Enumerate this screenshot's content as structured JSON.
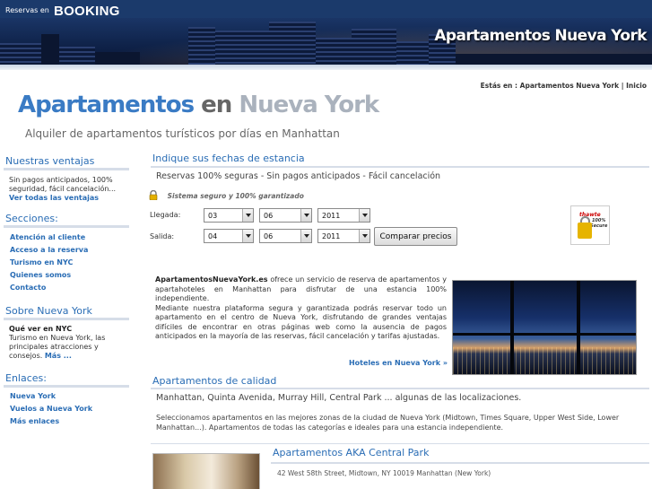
{
  "topbar": {
    "pre": "Reservas en",
    "brand": "BOOKING"
  },
  "banner": {
    "title": "Apartamentos Nueva York"
  },
  "breadcrumb": {
    "prefix": "Estás en :",
    "current": "Apartamentos Nueva York",
    "sep": "|",
    "home": "Inicio"
  },
  "page": {
    "title_1": "Apartamentos",
    "title_2": "en",
    "title_3": "Nueva York",
    "subtitle": "Alquiler de apartamentos turísticos por días en Manhattan"
  },
  "sidebar": {
    "ventas": {
      "heading": "Nuestras ventajas",
      "text": "Sin pagos anticipados, 100% seguridad, fácil cancelación...",
      "link": "Ver todas las ventajas"
    },
    "secciones": {
      "heading": "Secciones:",
      "items": [
        "Atención al cliente",
        "Acceso a la reserva",
        "Turismo en NYC",
        "Quienes somos",
        "Contacto"
      ]
    },
    "sobre": {
      "heading": "Sobre Nueva York",
      "bold": "Qué ver en NYC",
      "text": "Turismo en Nueva York, las principales atracciones y consejos.",
      "link": "Más ..."
    },
    "enlaces": {
      "heading": "Enlaces:",
      "items": [
        "Nueva York",
        "Vuelos a Nueva York",
        "Más enlaces"
      ]
    }
  },
  "search": {
    "heading": "Indique sus fechas de estancia",
    "tagline": "Reservas 100% seguras - Sin pagos anticipados - Fácil cancelación",
    "secure": "Sistema seguro y 100% garantizado",
    "checkin_label": "Llegada:",
    "checkout_label": "Salida:",
    "checkin": {
      "day": "03",
      "month": "06",
      "year": "2011"
    },
    "checkout": {
      "day": "04",
      "month": "06",
      "year": "2011"
    },
    "button": "Comparar precios"
  },
  "badge": {
    "name": "thawte",
    "line1": "100%",
    "line2": "Secure"
  },
  "intro": {
    "brand": "ApartamentosNuevaYork.es",
    "p1": "ofrece un servicio de reserva de apartamentos y apartahoteles en Manhattan para disfrutar de una estancia 100% independiente.",
    "p2": "Mediante nuestra plataforma segura y garantizada podrás reservar todo un apartamento en el centro de Nueva York, disfrutando de grandes ventajas difíciles de encontrar en otras páginas web como la ausencia de pagos anticipados en la mayoría de las reservas, fácil cancelación y tarifas ajustadas.",
    "link": "Hoteles en Nueva York »"
  },
  "calidad": {
    "heading": "Apartamentos de calidad",
    "line1": "Manhattan, Quinta Avenida, Murray Hill, Central Park ... algunas de las localizaciones.",
    "line2": "Seleccionamos apartamentos en las mejores zonas de la ciudad de Nueva York (Midtown, Times Square, Upper West Side, Lower",
    "line3": "Manhattan...). Apartamentos de todas las categorías e ideales para una estancia independiente."
  },
  "hotel": {
    "title": "Apartamentos AKA Central Park",
    "address": "42 West 58th Street, Midtown, NY 10019 Manhattan (New York)"
  },
  "colors": {
    "topbar": "#1b3a6b",
    "link": "#2a6db5",
    "title_blue": "#3a7bc4"
  }
}
